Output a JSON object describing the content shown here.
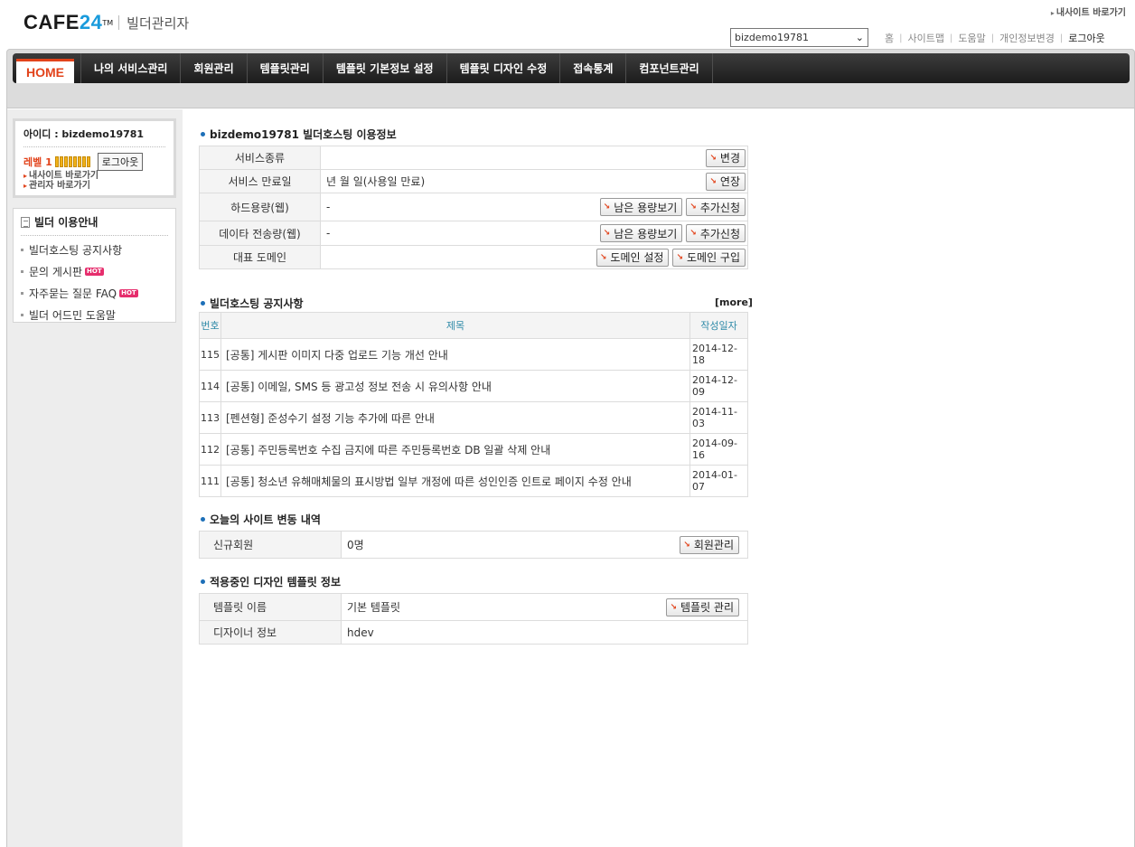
{
  "header": {
    "logo_word": "CAFE",
    "logo_num": "24",
    "logo_tm": "TM",
    "logo_sub": "빌더관리자",
    "external_link": "내사이트 바로가기",
    "site_select_value": "bizdemo19781",
    "links": [
      "홈",
      "사이트맵",
      "도움말",
      "개인정보변경"
    ],
    "logout": "로그아웃"
  },
  "nav": {
    "home": "HOME",
    "items": [
      "나의 서비스관리",
      "회원관리",
      "템플릿관리",
      "템플릿 기본정보 설정",
      "템플릿 디자인 수정",
      "접속통계",
      "컴포넌트관리"
    ]
  },
  "sidebar": {
    "user_id": "아이디 : bizdemo19781",
    "level_label": "레벨 1",
    "logout_button": "로그아웃",
    "link_my_site": "내사이트 바로가기",
    "link_admin": "관리자 바로가기",
    "guide_title": "빌더 이용안내",
    "guide_items": [
      {
        "label": "빌더호스팅 공지사항",
        "hot": ""
      },
      {
        "label": "문의 게시판",
        "hot": "HOT"
      },
      {
        "label": "자주묻는 질문 FAQ",
        "hot": "HOT"
      },
      {
        "label": "빌더 어드민 도움말",
        "hot": ""
      }
    ]
  },
  "usage": {
    "title": "bizdemo19781 빌더호스팅 이용정보",
    "rows": [
      {
        "label": "서비스종류",
        "value": "",
        "buttons": [
          "변경"
        ]
      },
      {
        "label": "서비스 만료일",
        "value": "년 월 일(사용일 만료)",
        "buttons": [
          "연장"
        ]
      },
      {
        "label": "하드용량(웹)",
        "value": "-",
        "buttons": [
          "남은 용량보기",
          "추가신청"
        ]
      },
      {
        "label": "데이타 전송량(웹)",
        "value": "-",
        "buttons": [
          "남은 용량보기",
          "추가신청"
        ]
      },
      {
        "label": "대표 도메인",
        "value": "",
        "buttons": [
          "도메인 설정",
          "도메인 구입"
        ]
      }
    ]
  },
  "notice": {
    "title": "빌더호스팅 공지사항",
    "more": "[more]",
    "headers": [
      "번호",
      "제목",
      "작성일자"
    ],
    "rows": [
      {
        "no": "115",
        "subject": "[공통] 게시판 이미지 다중 업로드 기능 개선 안내",
        "date": "2014-12-18"
      },
      {
        "no": "114",
        "subject": "[공통] 이메일, SMS 등 광고성 정보 전송 시 유의사항 안내",
        "date": "2014-12-09"
      },
      {
        "no": "113",
        "subject": "[펜션형] 준성수기 설정 기능 추가에 따른 안내",
        "date": "2014-11-03"
      },
      {
        "no": "112",
        "subject": "[공통] 주민등록번호 수집 금지에 따른 주민등록번호 DB 일괄 삭제 안내",
        "date": "2014-09-16"
      },
      {
        "no": "111",
        "subject": "[공통] 청소년 유해매체물의 표시방법 일부 개정에 따른 성인인증 인트로 페이지 수정 안내",
        "date": "2014-01-07"
      }
    ]
  },
  "today": {
    "title": "오늘의 사이트 변동 내역",
    "label": "신규회원",
    "value": "0명",
    "button": "회원관리"
  },
  "template": {
    "title": "적용중인 디자인 템플릿 정보",
    "name_label": "템플릿 이름",
    "name_value": "기본 템플릿",
    "name_button": "템플릿 관리",
    "designer_label": "디자이너 정보",
    "designer_value": "hdev"
  }
}
